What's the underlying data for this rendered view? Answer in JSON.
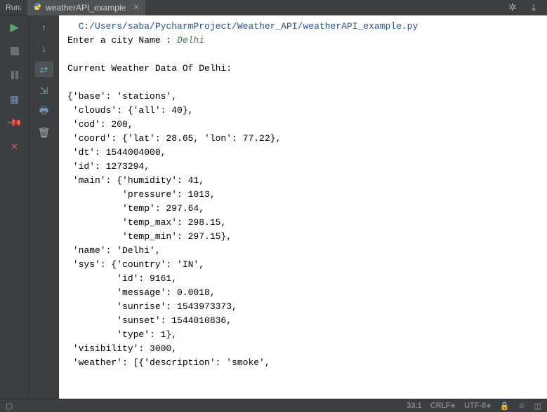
{
  "topbar": {
    "run_label": "Run:",
    "tab_name": "weatherAPI_example"
  },
  "console": {
    "path": "C:/Users/saba/PycharmProject/Weather_API/weatherAPI_example.py",
    "prompt": "Enter a city Name : ",
    "input": "Delhi",
    "header": "Current Weather Data Of Delhi:",
    "lines": [
      "{'base': 'stations',",
      " 'clouds': {'all': 40},",
      " 'cod': 200,",
      " 'coord': {'lat': 28.65, 'lon': 77.22},",
      " 'dt': 1544004000,",
      " 'id': 1273294,",
      " 'main': {'humidity': 41,",
      "          'pressure': 1013,",
      "          'temp': 297.64,",
      "          'temp_max': 298.15,",
      "          'temp_min': 297.15},",
      " 'name': 'Delhi',",
      " 'sys': {'country': 'IN',",
      "         'id': 9161,",
      "         'message': 0.0018,",
      "         'sunrise': 1543973373,",
      "         'sunset': 1544010836,",
      "         'type': 1},",
      " 'visibility': 3000,",
      " 'weather': [{'description': 'smoke',"
    ]
  },
  "statusbar": {
    "pos": "33:1",
    "line_sep": "CRLF",
    "encoding": "UTF-8"
  }
}
